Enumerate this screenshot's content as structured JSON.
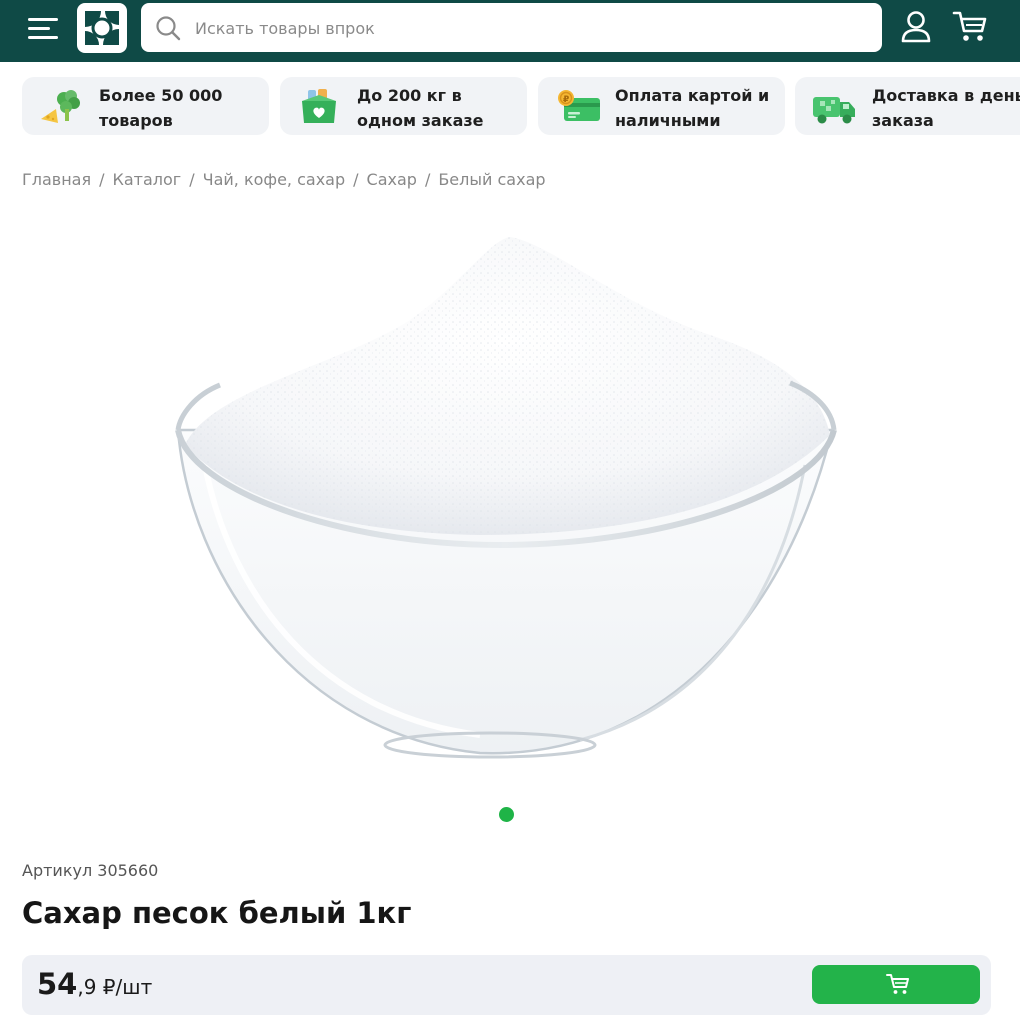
{
  "header": {
    "search_placeholder": "Искать товары впрок",
    "background_color": "#0f4a46"
  },
  "icons": {
    "menu": "menu-icon",
    "logo": "store-logo",
    "search": "search-icon",
    "user": "user-icon",
    "cart": "cart-icon"
  },
  "features": [
    {
      "text": "Более 50 000 товаров",
      "icon": "groceries-icon"
    },
    {
      "text": "До 200 кг в одном заказе",
      "icon": "package-icon"
    },
    {
      "text": "Оплата картой и наличными",
      "icon": "payment-card-icon"
    },
    {
      "text": "Доставка в день заказа",
      "icon": "delivery-truck-icon"
    }
  ],
  "breadcrumb": [
    "Главная",
    "Каталог",
    "Чай, кофе, сахар",
    "Сахар",
    "Белый сахар"
  ],
  "product": {
    "article": "Артикул 305660",
    "title": "Сахар песок белый 1кг",
    "price_int": "54",
    "price_frac": ",9",
    "price_unit": " ₽/шт",
    "image_count": 1,
    "active_image": 1
  },
  "colors": {
    "accent_green": "#23b34a",
    "price_bar_bg": "#eef0f5"
  }
}
